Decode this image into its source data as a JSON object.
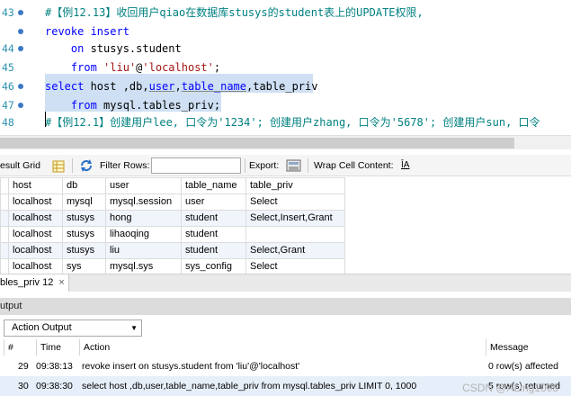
{
  "editor": {
    "lines": [
      {
        "num": "43",
        "segments": [
          {
            "t": "#【例12.13】收回用户qiao在数据库stusys的student表上的UPDATE权限,",
            "c": "cm"
          }
        ]
      },
      {
        "num": "",
        "segments": [
          {
            "t": "revoke insert",
            "c": "kw"
          }
        ]
      },
      {
        "num": "44",
        "segments": [
          {
            "t": "    "
          },
          {
            "t": "on",
            "c": "kw"
          },
          {
            "t": " stusys.student"
          }
        ]
      },
      {
        "num": "45",
        "segments": [
          {
            "t": "    "
          },
          {
            "t": "from",
            "c": "kw"
          },
          {
            "t": " "
          },
          {
            "t": "'liu'",
            "c": "str"
          },
          {
            "t": "@"
          },
          {
            "t": "'localhost'",
            "c": "str"
          },
          {
            "t": ";"
          }
        ]
      },
      {
        "num": "46",
        "segments": [
          {
            "t": "select",
            "c": "kw"
          },
          {
            "t": " host ,db,"
          },
          {
            "t": "user",
            "c": "kw ul"
          },
          {
            "t": ","
          },
          {
            "t": "table_name",
            "c": "kw ul"
          },
          {
            "t": ",table_priv"
          }
        ]
      },
      {
        "num": "47",
        "segments": [
          {
            "t": "    "
          },
          {
            "t": "from",
            "c": "kw"
          },
          {
            "t": " mysql.tables_priv;"
          }
        ]
      },
      {
        "num": "48",
        "segments": [
          {
            "t": "#【例12.1】创建用户lee, 口令为'1234'; 创建用户zhang, 口令为'5678'; 创建用户sun, 口令",
            "c": "cm"
          }
        ]
      }
    ]
  },
  "toolbar": {
    "result_grid_label": "esult Grid",
    "filter_rows_label": "Filter Rows:",
    "filter_value": "",
    "export_label": "Export:",
    "wrap_label": "Wrap Cell Content:",
    "wrap_icon": "ĪA"
  },
  "grid": {
    "columns": [
      "host",
      "db",
      "user",
      "table_name",
      "table_priv"
    ],
    "rows": [
      [
        "localhost",
        "mysql",
        "mysql.session",
        "user",
        "Select"
      ],
      [
        "localhost",
        "stusys",
        "hong",
        "student",
        "Select,Insert,Grant"
      ],
      [
        "localhost",
        "stusys",
        "lihaoqing",
        "student",
        ""
      ],
      [
        "localhost",
        "stusys",
        "liu",
        "student",
        "Select,Grant"
      ],
      [
        "localhost",
        "sys",
        "mysql.sys",
        "sys_config",
        "Select"
      ]
    ]
  },
  "result_tab": {
    "label": "bles_priv 12",
    "close": "×"
  },
  "output": {
    "header": "utput",
    "selector": "Action Output",
    "columns": {
      "num": "#",
      "time": "Time",
      "action": "Action",
      "message": "Message"
    },
    "rows": [
      {
        "num": "29",
        "time": "09:38:13",
        "action": "revoke insert on stusys.student     from 'liu'@'localhost'",
        "message": "0 row(s) affected"
      },
      {
        "num": "30",
        "time": "09:38:30",
        "action": "select host ,db,user,table_name,table_priv from mysql.tables_priv LIMIT 0, 1000",
        "message": "5 row(s) returned"
      }
    ]
  },
  "watermark": "CSDN @ALing1008",
  "colors": {
    "keyword": "#0000ff",
    "comment": "#008080",
    "string": "#a31515",
    "selection": "#cfe0f4"
  }
}
